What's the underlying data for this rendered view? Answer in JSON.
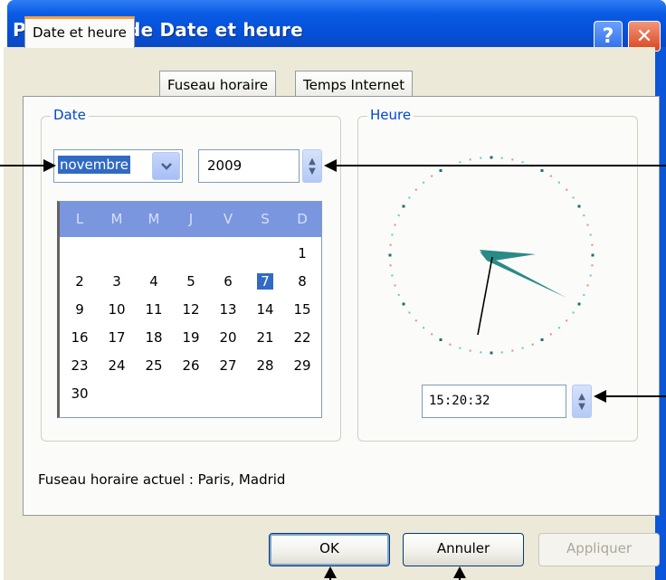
{
  "window": {
    "title": "Propriétés de Date et heure",
    "help_glyph": "?",
    "close_glyph": "✕"
  },
  "tabs": [
    {
      "label": "Date et heure",
      "active": true
    },
    {
      "label": "Fuseau horaire",
      "active": false
    },
    {
      "label": "Temps Internet",
      "active": false
    }
  ],
  "date_group": {
    "label": "Date",
    "month": "novembre",
    "year": "2009",
    "weekday_headers": [
      "L",
      "M",
      "M",
      "J",
      "V",
      "S",
      "D"
    ],
    "weeks": [
      [
        "",
        "",
        "",
        "",
        "",
        "",
        "1"
      ],
      [
        "2",
        "3",
        "4",
        "5",
        "6",
        "7",
        "8"
      ],
      [
        "9",
        "10",
        "11",
        "12",
        "13",
        "14",
        "15"
      ],
      [
        "16",
        "17",
        "18",
        "19",
        "20",
        "21",
        "22"
      ],
      [
        "23",
        "24",
        "25",
        "26",
        "27",
        "28",
        "29"
      ],
      [
        "30",
        "",
        "",
        "",
        "",
        "",
        ""
      ]
    ],
    "selected_day": "7"
  },
  "time_group": {
    "label": "Heure",
    "time": "15:20:32"
  },
  "status": {
    "current_timezone": "Fuseau horaire actuel : Paris, Madrid"
  },
  "buttons": {
    "ok": "OK",
    "cancel": "Annuler",
    "apply": "Appliquer"
  },
  "colors": {
    "titlebar": "#0550d8",
    "selection": "#316ac5",
    "calendar_header": "#7a96df",
    "clock_hands": "#2a8a86",
    "group_label": "#0046d5"
  }
}
